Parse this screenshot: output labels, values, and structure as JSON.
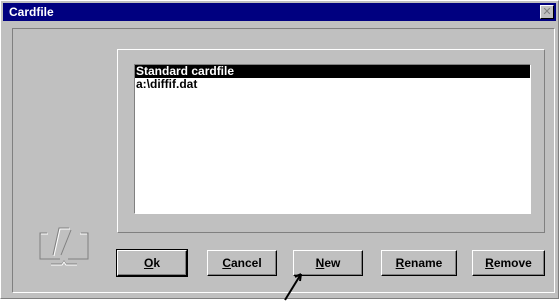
{
  "window": {
    "title": "Cardfile",
    "close_glyph": "✕"
  },
  "list": {
    "items": [
      {
        "label": "Standard cardfile",
        "selected": true
      },
      {
        "label": "a:\\diffif.dat",
        "selected": false
      }
    ]
  },
  "buttons": {
    "ok": {
      "mnemonic": "O",
      "rest": "k"
    },
    "cancel": {
      "mnemonic": "C",
      "rest": "ancel"
    },
    "new": {
      "mnemonic": "N",
      "rest": "ew"
    },
    "rename": {
      "mnemonic": "R",
      "rest": "ename"
    },
    "remove": {
      "mnemonic": "R",
      "rest": "emove"
    }
  },
  "icons": {
    "title_close": "close-icon",
    "app_logo": "book-icon",
    "mouse_pointer": "arrow-cursor-icon"
  },
  "colors": {
    "title_bar": "#000080",
    "dialog_face": "#c0c0c0",
    "selection": "#000000",
    "disabled_icon": "#808080"
  }
}
